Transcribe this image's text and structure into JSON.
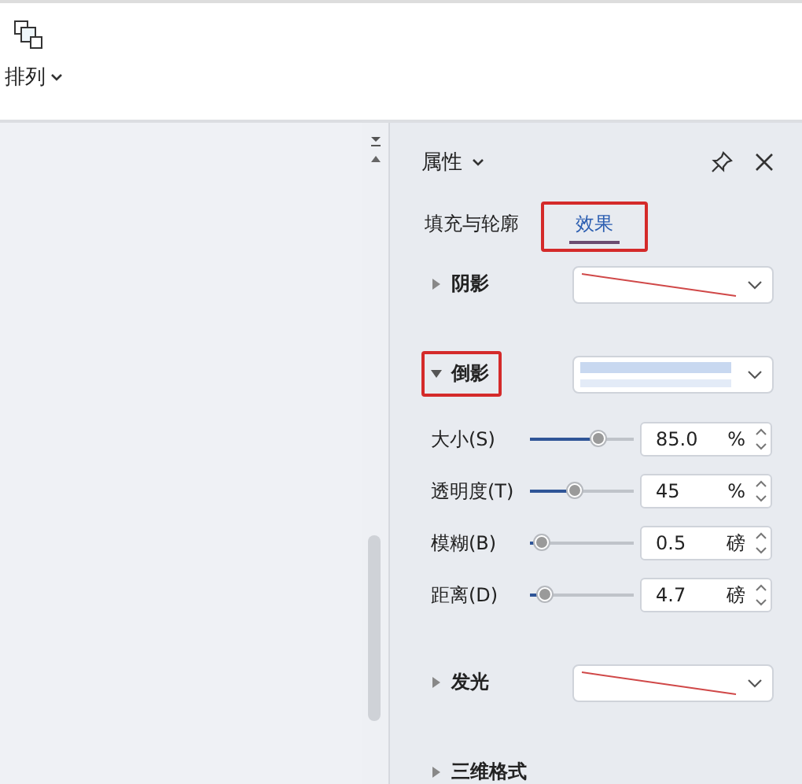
{
  "ribbon": {
    "arrange_label": "排列"
  },
  "panel": {
    "title": "属性",
    "tabs": [
      {
        "label": "填充与轮廓",
        "selected": false,
        "highlighted": false
      },
      {
        "label": "效果",
        "selected": true,
        "highlighted": true
      }
    ],
    "sections": [
      {
        "label": "阴影",
        "expanded": false,
        "highlighted": false,
        "kind": "none"
      },
      {
        "label": "倒影",
        "expanded": true,
        "highlighted": true,
        "kind": "reflection",
        "controls": [
          {
            "label": "大小(S)",
            "level": 0.73,
            "value": "85.0",
            "unit": "%"
          },
          {
            "label": "透明度(T)",
            "level": 0.45,
            "value": "45",
            "unit": "%"
          },
          {
            "label": "模糊(B)",
            "level": 0.05,
            "value": "0.5",
            "unit": "磅"
          },
          {
            "label": "距离(D)",
            "level": 0.1,
            "value": "4.7",
            "unit": "磅"
          }
        ]
      },
      {
        "label": "发光",
        "expanded": false,
        "highlighted": false,
        "kind": "none"
      },
      {
        "label": "三维格式",
        "expanded": false,
        "highlighted": false,
        "kind": "plain"
      }
    ]
  }
}
